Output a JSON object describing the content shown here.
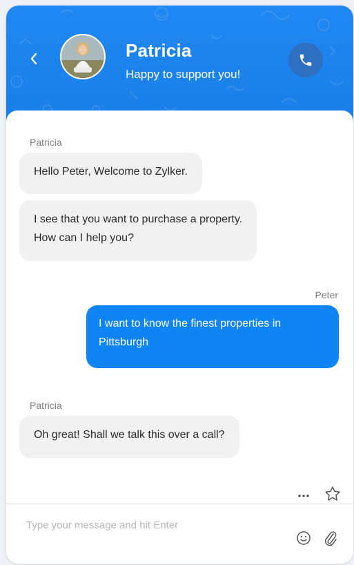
{
  "header": {
    "name": "Patricia",
    "status": "Happy to support you!",
    "colors": {
      "accent": "#1a7ee8",
      "call_button": "#2d6fc0"
    },
    "icons": {
      "back": "chevron-left-icon",
      "call": "phone-icon"
    }
  },
  "messages": [
    {
      "sender": "Patricia",
      "direction": "incoming",
      "text": "Hello Peter, Welcome to Zylker."
    },
    {
      "sender": "",
      "direction": "incoming",
      "text_lines": [
        "I see that you want to purchase a property.",
        "How can I help you?"
      ]
    },
    {
      "sender": "Peter",
      "direction": "outgoing",
      "text_lines": [
        "I want to know the finest properties in",
        "Pittsburgh"
      ]
    },
    {
      "sender": "Patricia",
      "direction": "incoming",
      "text": "Oh great! Shall we talk this over a call?"
    }
  ],
  "actions": {
    "more_icon": "more-dots-icon",
    "star_icon": "star-icon"
  },
  "composer": {
    "placeholder": "Type your message and hit Enter",
    "emoji_icon": "emoji-icon",
    "attach_icon": "paperclip-icon"
  },
  "colors": {
    "outgoing_bubble": "#0f84f4",
    "incoming_bubble": "#f1f1f2"
  }
}
